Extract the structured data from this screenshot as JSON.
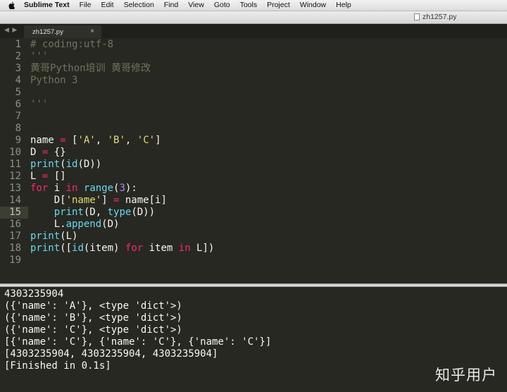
{
  "menubar": {
    "app_name": "Sublime Text",
    "items": [
      "File",
      "Edit",
      "Selection",
      "Find",
      "View",
      "Goto",
      "Tools",
      "Project",
      "Window",
      "Help"
    ]
  },
  "window": {
    "title": "zh1257.py"
  },
  "tabs": [
    {
      "label": "zh1257.py",
      "close": "×"
    }
  ],
  "nav_arrows": "◀ ▶",
  "editor": {
    "current_line": 15,
    "lines": [
      {
        "n": "1",
        "t": "# coding:utf-8"
      },
      {
        "n": "2",
        "t": "'''"
      },
      {
        "n": "3",
        "t": "黄哥Python培训 黄哥修改"
      },
      {
        "n": "4",
        "t": "Python 3"
      },
      {
        "n": "5",
        "t": ""
      },
      {
        "n": "6",
        "t": "'''"
      },
      {
        "n": "7",
        "t": ""
      },
      {
        "n": "8",
        "t": ""
      },
      {
        "n": "9",
        "t": "name = ['A', 'B', 'C']"
      },
      {
        "n": "10",
        "t": "D = {}"
      },
      {
        "n": "11",
        "t": "print(id(D))"
      },
      {
        "n": "12",
        "t": "L = []"
      },
      {
        "n": "13",
        "t": "for i in range(3):"
      },
      {
        "n": "14",
        "t": "    D['name'] = name[i]"
      },
      {
        "n": "15",
        "t": "    print(D, type(D))"
      },
      {
        "n": "16",
        "t": "    L.append(D)"
      },
      {
        "n": "17",
        "t": "print(L)"
      },
      {
        "n": "18",
        "t": "print([id(item) for item in L])"
      },
      {
        "n": "19",
        "t": ""
      }
    ]
  },
  "output": {
    "lines": [
      "4303235904",
      "({'name': 'A'}, <type 'dict'>)",
      "({'name': 'B'}, <type 'dict'>)",
      "({'name': 'C'}, <type 'dict'>)",
      "[{'name': 'C'}, {'name': 'C'}, {'name': 'C'}]",
      "[4303235904, 4303235904, 4303235904]",
      "[Finished in 0.1s]"
    ]
  },
  "watermark": "知乎用户",
  "colors": {
    "background": "#272822",
    "keyword": "#f92672",
    "string": "#e6db74",
    "function": "#66d9ef",
    "number": "#ae81ff",
    "comment": "#75715e"
  }
}
